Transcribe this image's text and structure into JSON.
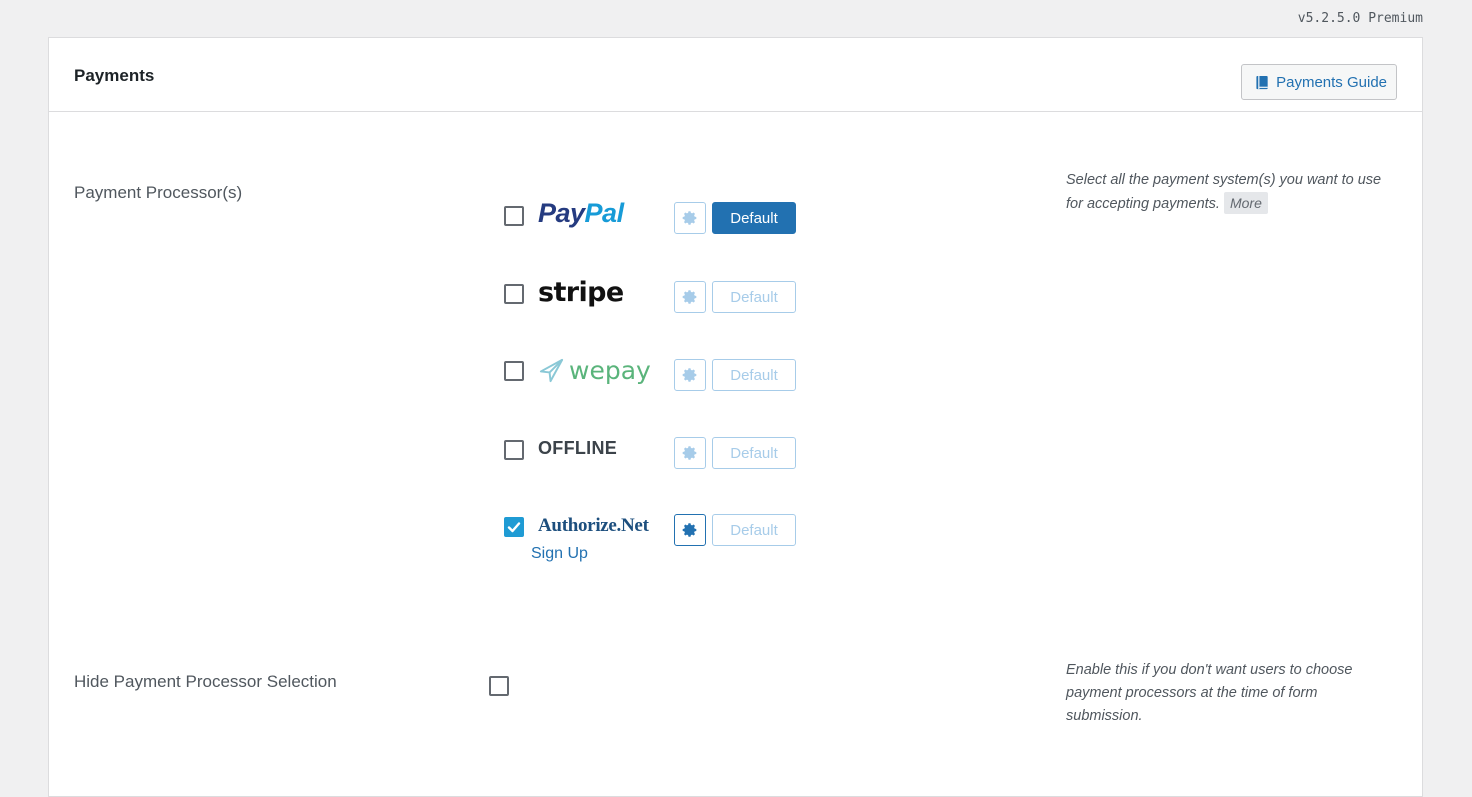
{
  "version": "v5.2.5.0 Premium",
  "panel": {
    "title": "Payments",
    "guide_button": "Payments Guide"
  },
  "payment_processors": {
    "label": "Payment Processor(s)",
    "help_text": "Select all the payment system(s) you want to use for accepting payments.",
    "more_label": "More",
    "items": [
      {
        "name": "PayPal",
        "logo_part1": "Pay",
        "logo_part2": "Pal",
        "checked": false,
        "default_label": "Default",
        "is_default": true
      },
      {
        "name": "stripe",
        "logo_text": "stripe",
        "checked": false,
        "default_label": "Default",
        "is_default": false
      },
      {
        "name": "wepay",
        "logo_text": "wepay",
        "checked": false,
        "default_label": "Default",
        "is_default": false
      },
      {
        "name": "OFFLINE",
        "logo_text": "OFFLINE",
        "checked": false,
        "default_label": "Default",
        "is_default": false
      },
      {
        "name": "Authorize.Net",
        "logo_text": "Authorize.Net",
        "checked": true,
        "default_label": "Default",
        "is_default": false,
        "signup_label": "Sign Up"
      }
    ]
  },
  "hide_selection": {
    "label": "Hide Payment Processor Selection",
    "help_text": "Enable this if you don't want users to choose payment processors at the time of form submission.",
    "checked": false
  },
  "colors": {
    "primary": "#2271b1",
    "checkbox_checked": "#1f9bd4",
    "paypal_dark": "#253b80",
    "paypal_light": "#179bd7",
    "wepay_green": "#5ab47b",
    "authnet_blue": "#1d4f7e"
  }
}
